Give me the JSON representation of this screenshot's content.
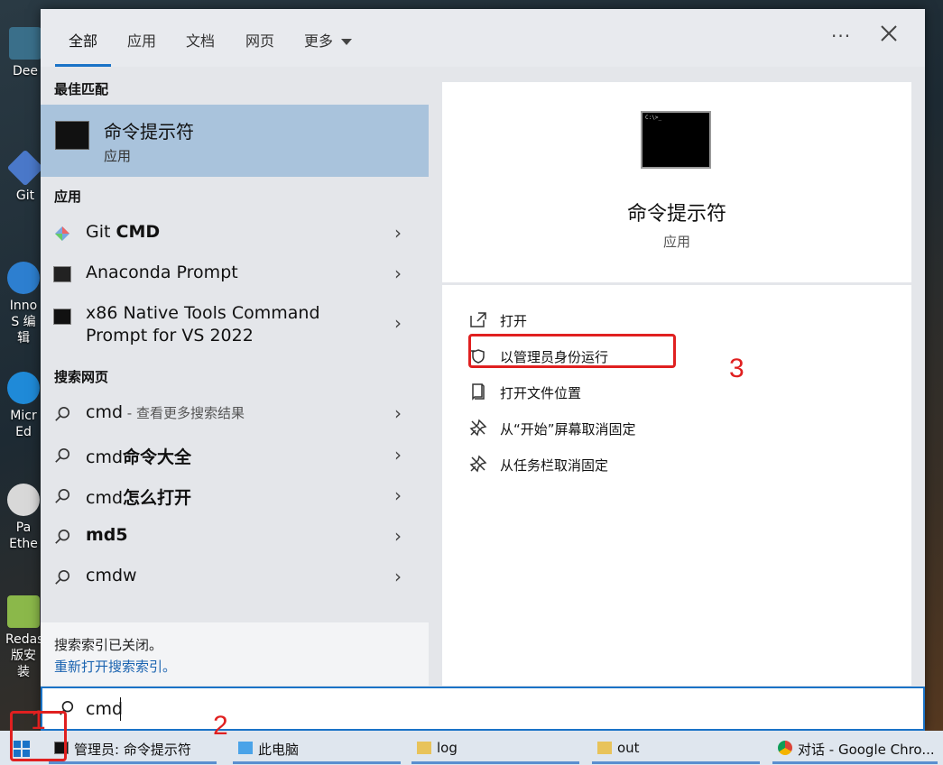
{
  "desktop": {
    "icons": [
      {
        "label": "Dee"
      },
      {
        "label": "Git"
      },
      {
        "label": "Inno S 编辑"
      },
      {
        "label": "Micr Ed"
      },
      {
        "label": "Pa Ethe"
      },
      {
        "label": "Redas 版安装"
      }
    ]
  },
  "tabs": [
    {
      "label": "全部",
      "active": true
    },
    {
      "label": "应用"
    },
    {
      "label": "文档"
    },
    {
      "label": "网页"
    },
    {
      "label": "更多"
    }
  ],
  "topbar": {
    "more_dots": "···"
  },
  "best_match": {
    "heading": "最佳匹配",
    "name": "命令提示符",
    "kind": "应用"
  },
  "apps": {
    "heading": "应用",
    "items": [
      {
        "label_plain": "Git ",
        "label_bold": "CMD"
      },
      {
        "label_plain": "Anaconda Prompt",
        "label_bold": ""
      },
      {
        "label_line1": "x86 Native Tools Command",
        "label_line2": "Prompt for VS 2022"
      }
    ]
  },
  "web": {
    "heading": "搜索网页",
    "items": [
      {
        "plain": "cmd",
        "bold": "",
        "suffix": " - 查看更多搜索结果"
      },
      {
        "plain": "cmd",
        "bold": "命令大全",
        "suffix": ""
      },
      {
        "plain": "cmd",
        "bold": "怎么打开",
        "suffix": ""
      },
      {
        "plain": "",
        "bold": "md5",
        "suffix": ""
      },
      {
        "plain": "cmdw",
        "bold": "",
        "suffix": ""
      }
    ]
  },
  "index_notice": {
    "line1": "搜索索引已关闭。",
    "link": "重新打开搜索索引。"
  },
  "detail": {
    "title": "命令提示符",
    "kind": "应用",
    "icon_text": "C:\\>_",
    "actions": [
      {
        "label": "打开",
        "icon": "open-icon"
      },
      {
        "label": "以管理员身份运行",
        "icon": "admin-shield-icon"
      },
      {
        "label": "打开文件位置",
        "icon": "file-location-icon"
      },
      {
        "label": "从“开始”屏幕取消固定",
        "icon": "unpin-icon"
      },
      {
        "label": "从任务栏取消固定",
        "icon": "unpin-icon"
      }
    ]
  },
  "search": {
    "value": "cmd"
  },
  "taskbar": {
    "items": [
      {
        "label": "管理员: 命令提示符"
      },
      {
        "label": "此电脑"
      },
      {
        "label": "log"
      },
      {
        "label": "out"
      },
      {
        "label": "对话 - Google Chro..."
      }
    ]
  },
  "annotations": {
    "n1": "1",
    "n2": "2",
    "n3": "3"
  },
  "colors": {
    "accent": "#1a73c7",
    "selection": "#a9c3dc",
    "annotation": "#e02020"
  }
}
